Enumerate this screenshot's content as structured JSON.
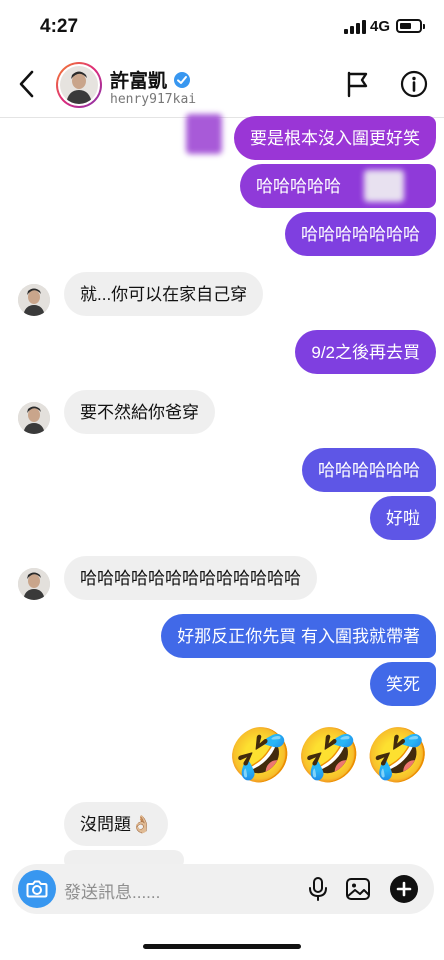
{
  "status_bar": {
    "time": "4:27",
    "network": "4G"
  },
  "header": {
    "name": "許富凱",
    "handle": "henry917kai"
  },
  "messages": {
    "m1": "要是根本沒入圍更好笑",
    "m2": "哈哈哈哈哈",
    "m3": "哈哈哈哈哈哈哈",
    "m4": "就...你可以在家自己穿",
    "m5": "9/2之後再去買",
    "m6": "要不然給你爸穿",
    "m7": "哈哈哈哈哈哈",
    "m8": "好啦",
    "m9": "哈哈哈哈哈哈哈哈哈哈哈哈哈",
    "m10": "好那反正你先買 有入圍我就帶著",
    "m11": "笑死",
    "m12": "🤣🤣🤣",
    "m13": "沒問題👌🏼"
  },
  "composer": {
    "placeholder": "發送訊息......"
  },
  "colors": {
    "sent_purple": "#9a36d6",
    "sent_indigo": "#5e56e6",
    "sent_blue": "#4169e8",
    "received": "#efefef",
    "camera": "#3897f0"
  },
  "icons": [
    "back-chevron-icon",
    "verified-badge-icon",
    "flag-icon",
    "info-icon",
    "camera-icon",
    "microphone-icon",
    "gallery-icon",
    "plus-icon"
  ]
}
